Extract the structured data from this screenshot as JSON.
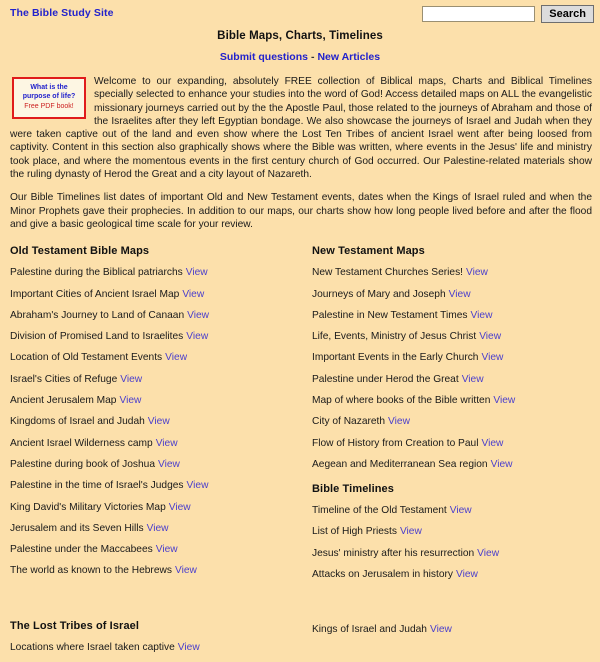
{
  "header": {
    "site_link": "The Bible Study Site",
    "search_placeholder": "",
    "search_value": "",
    "search_button": "Search",
    "page_title": "Bible Maps, Charts, Timelines",
    "subnav": {
      "submit": "Submit questions",
      "separator": "-",
      "new_articles": "New Articles"
    }
  },
  "promo": {
    "line1": "What is the",
    "line2": "purpose of life?",
    "line3": "Free PDF book!"
  },
  "intro": {
    "paragraph1": "Welcome to our expanding, absolutely FREE collection of Biblical maps, Charts and Biblical Timelines specially selected to enhance your studies into the word of God! Access detailed maps on ALL the evangelistic missionary journeys carried out by the the Apostle Paul, those related to the journeys of Abraham and those of the Israelites after they left Egyptian bondage. We also showcase the journeys of Israel and Judah when they were taken captive out of the land and even show where the Lost Ten Tribes of ancient Israel went after being loosed from captivity. Content in this section also graphically shows where the Bible was written, where events in the Jesus' life and ministry took place, and where the momentous events in the first century church of God occurred. Our Palestine-related materials show the ruling dynasty of Herod the Great and a city layout of Nazareth.",
    "paragraph2": "Our Bible Timelines list dates of important Old and New Testament events, dates when the Kings of Israel ruled and when the Minor Prophets gave their prophecies. In addition to our maps, our charts show how long people lived before and after the flood and give a basic geological time scale for your review."
  },
  "view_label": "View",
  "left_column": {
    "heading1": "Old Testament Bible Maps",
    "items1": [
      "Palestine during the Biblical patriarchs",
      "Important Cities of Ancient Israel Map",
      "Abraham's Journey to Land of Canaan",
      "Division of Promised Land to Israelites",
      "Location of Old Testament Events",
      "Israel's Cities of Refuge",
      "Ancient Jerusalem Map",
      "Kingdoms of Israel and Judah",
      "Ancient Israel Wilderness camp",
      "Palestine during book of Joshua",
      "Palestine in the time of Israel's Judges",
      "King David's Military Victories Map",
      "Jerusalem and its Seven Hills",
      "Palestine under the Maccabees",
      "The world as known to the Hebrews"
    ],
    "heading2": "The Lost Tribes of Israel",
    "items2": [
      "Locations where Israel taken captive"
    ]
  },
  "right_column": {
    "heading1": "New Testament Maps",
    "items1": [
      "New Testament Churches Series!",
      "Journeys of Mary and Joseph",
      "Palestine in New Testament Times",
      "Life, Events, Ministry of Jesus Christ",
      "Important Events in the Early Church",
      "Palestine under Herod the Great",
      "Map of where books of the Bible written",
      "City of Nazareth",
      "Flow of History from Creation to Paul",
      "Aegean and Mediterranean Sea region"
    ],
    "heading2": "Bible Timelines",
    "items2": [
      "Timeline of the Old Testament",
      "List of High Priests",
      "Jesus' ministry after his resurrection",
      "Attacks on Jerusalem in history"
    ],
    "items3": [
      "Kings of Israel and Judah"
    ]
  }
}
